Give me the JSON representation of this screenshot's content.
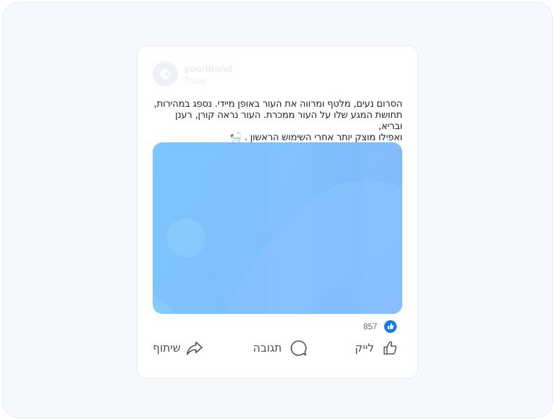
{
  "post": {
    "brand_name": "yourbrand",
    "timestamp": "Today",
    "text_lines": [
      "הסרום נעים, מלטף ומרווה את העור באופן מיידי. נספג במהירות,",
      "תחושת המגע שלו על העור ממכרת. העור נראה קורן, רענן ובריא,",
      "ואפילו מוצק יותר אחרי השימוש הראשון . 🛀🏻"
    ],
    "image_icon": "gradient-image-placeholder",
    "colors": {
      "image_gradient_start": "#7cc4fb",
      "image_gradient_end": "#84b8fd",
      "like_blue": "#1877f2"
    }
  },
  "reactions": {
    "count": "857",
    "icon": "like-badge-icon"
  },
  "actions": {
    "share_label": "שיתוף",
    "comment_label": "תגובה",
    "like_label": "לייק"
  }
}
